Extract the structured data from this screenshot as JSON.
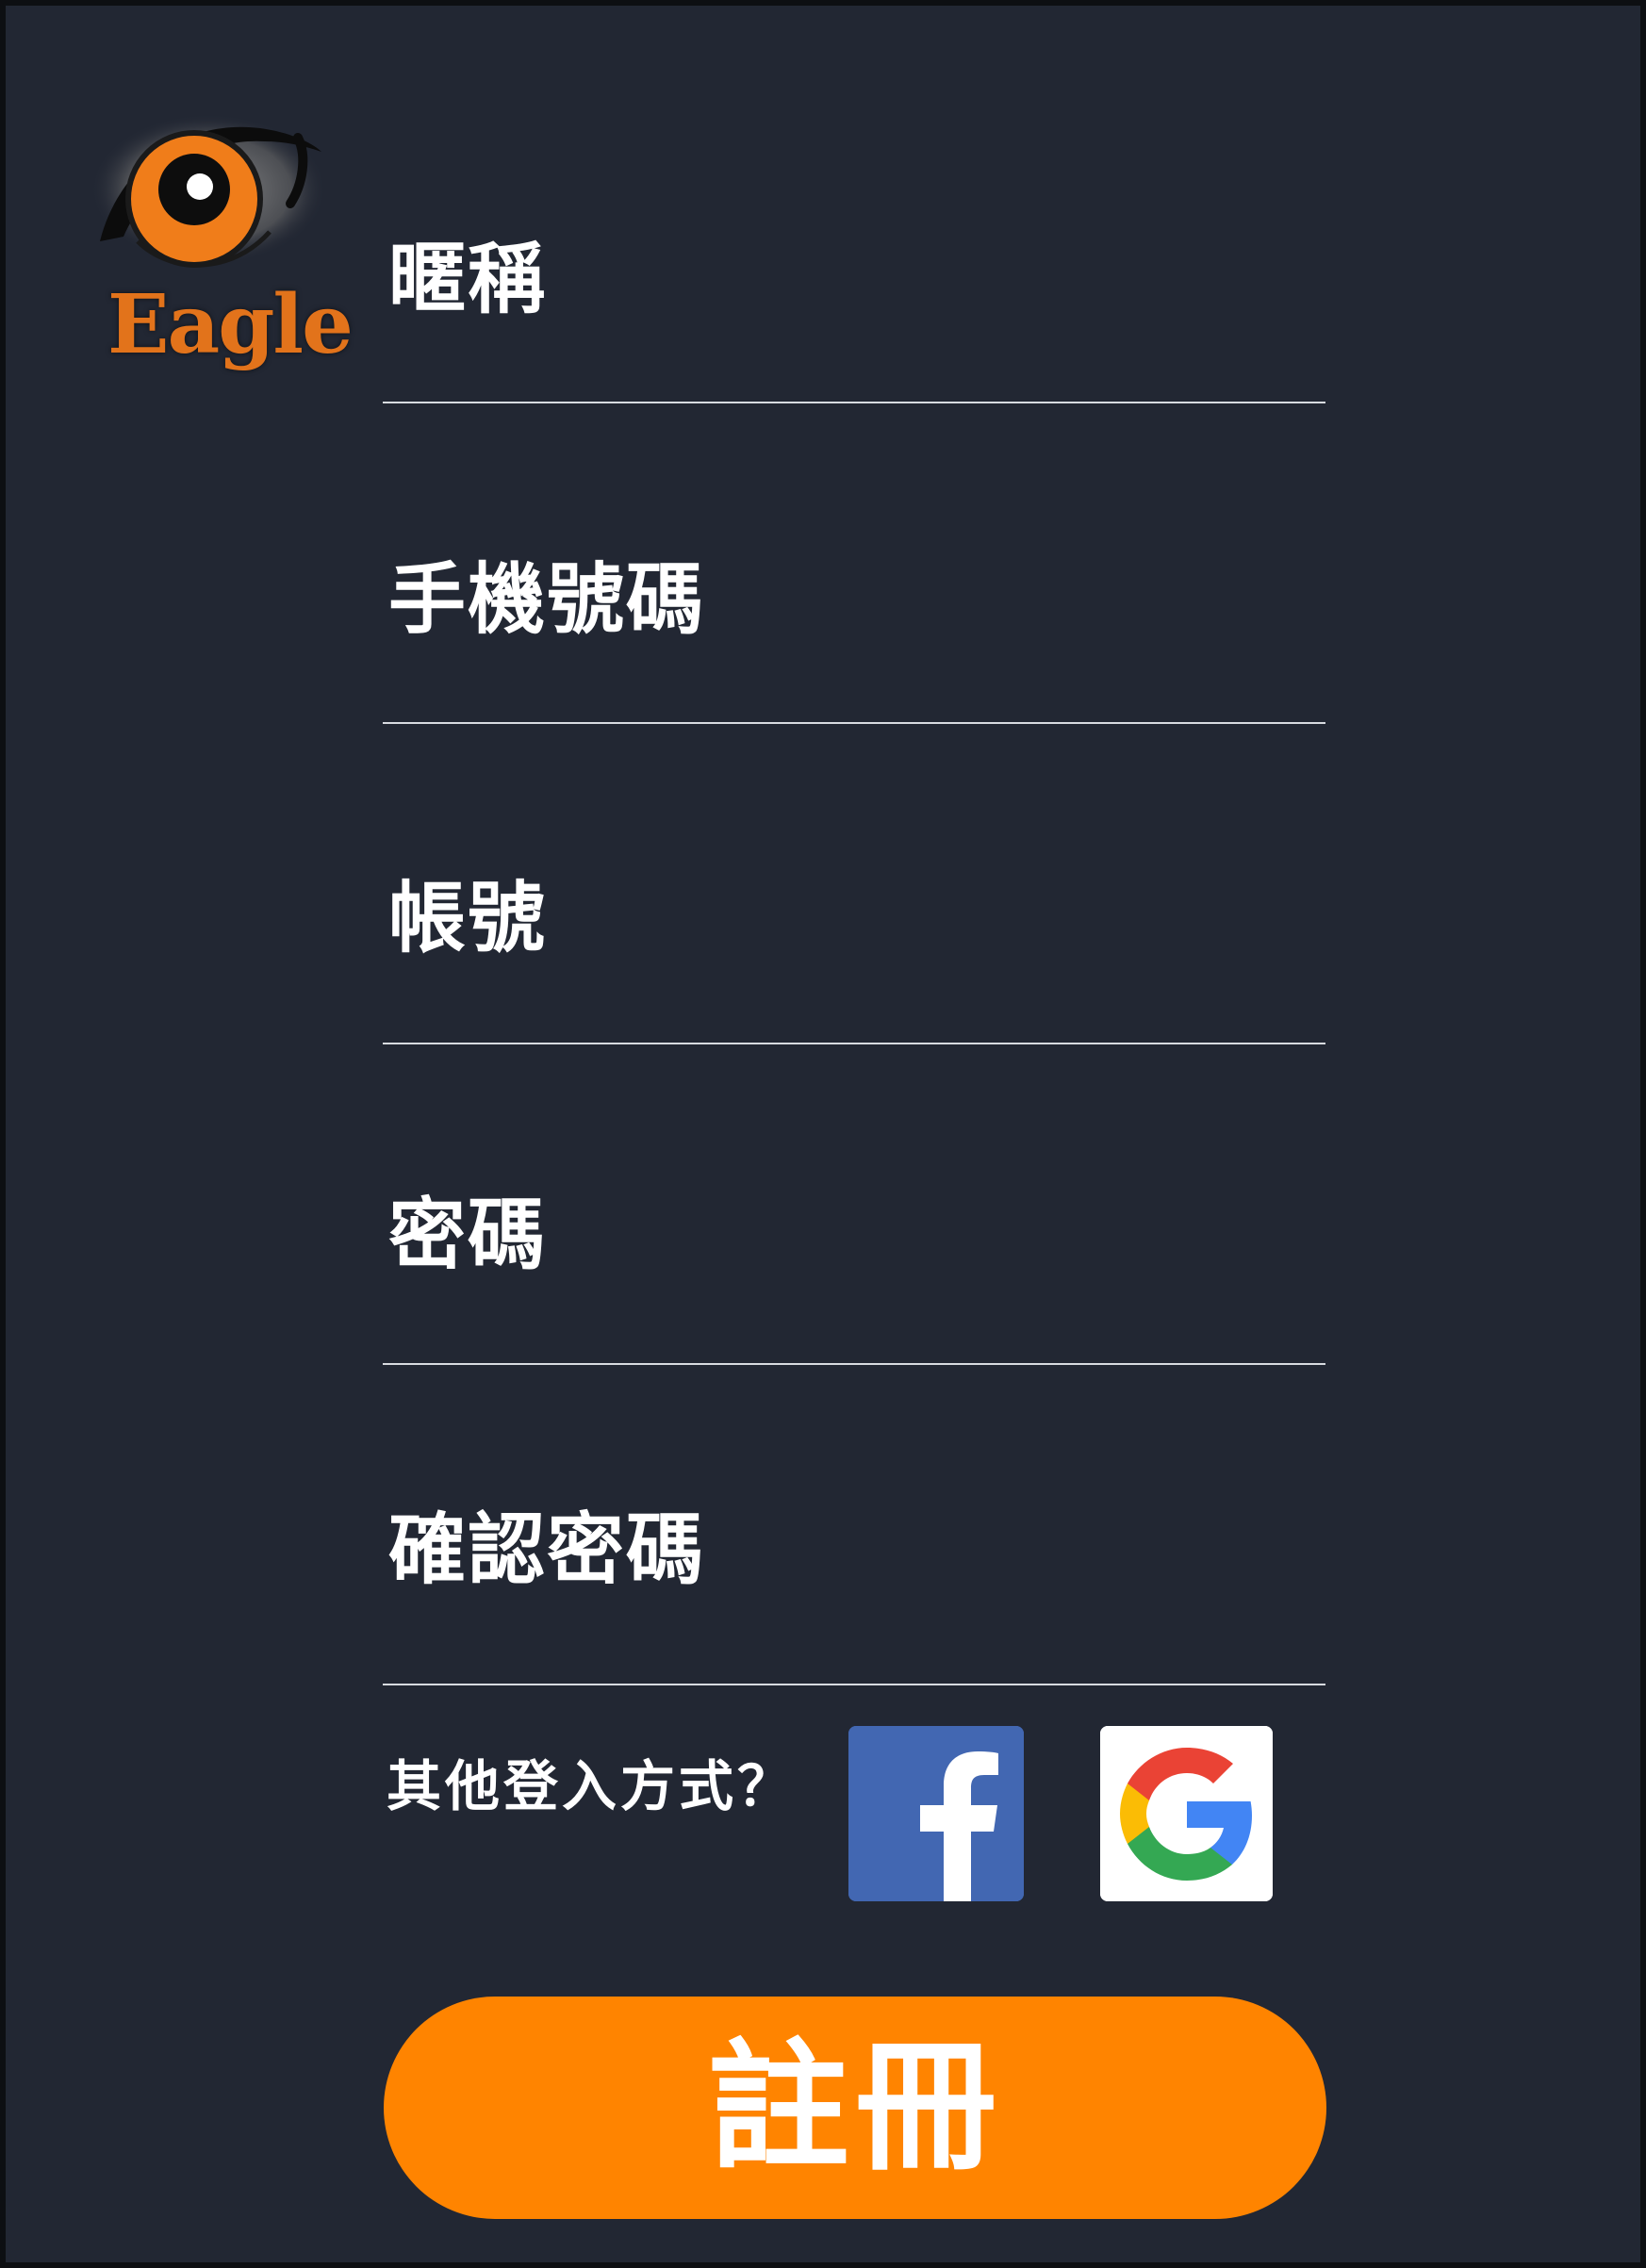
{
  "logo": {
    "text": "Eagle",
    "icon": "eagle-eye-icon",
    "text_color": "#e2731b",
    "iris_color": "#f07d1a"
  },
  "form": {
    "fields": [
      {
        "label": "暱稱",
        "value": "",
        "placeholder": ""
      },
      {
        "label": "手機號碼",
        "value": "",
        "placeholder": ""
      },
      {
        "label": "帳號",
        "value": "",
        "placeholder": ""
      },
      {
        "label": "密碼",
        "value": "",
        "placeholder": ""
      },
      {
        "label": "確認密碼",
        "value": "",
        "placeholder": ""
      }
    ]
  },
  "social": {
    "label": "其他登入方式？",
    "facebook_icon": "facebook-icon",
    "google_icon": "google-icon",
    "facebook_color": "#4267b2"
  },
  "register": {
    "label": "註冊",
    "color": "#ff8400"
  },
  "theme": {
    "background": "#222733",
    "text": "#ffffff",
    "divider": "#d8dbe0"
  }
}
